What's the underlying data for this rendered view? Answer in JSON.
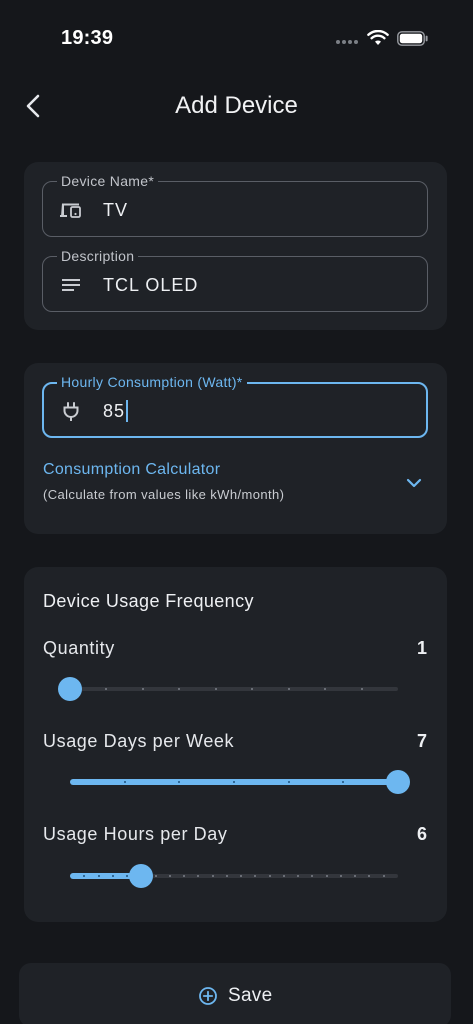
{
  "status_bar": {
    "time": "19:39"
  },
  "app_bar": {
    "title": "Add Device",
    "back_icon": "chevron-left-icon"
  },
  "device_card": {
    "name_field": {
      "label": "Device Name*",
      "value": "TV",
      "icon": "devices-icon"
    },
    "description_field": {
      "label": "Description",
      "value": "TCL OLED",
      "icon": "notes-icon"
    }
  },
  "consumption_card": {
    "hourly_field": {
      "label": "Hourly Consumption (Watt)*",
      "value": "85",
      "icon": "plug-icon"
    },
    "calculator": {
      "title": "Consumption Calculator",
      "subtitle": "(Calculate from values like kWh/month)",
      "icon": "chevron-down-icon"
    }
  },
  "usage_card": {
    "title": "Device Usage Frequency",
    "sliders": [
      {
        "label": "Quantity",
        "value": "1",
        "min": 1,
        "max": 10,
        "current": 1
      },
      {
        "label": "Usage Days per Week",
        "value": "7",
        "min": 1,
        "max": 7,
        "current": 7
      },
      {
        "label": "Usage Hours per Day",
        "value": "6",
        "min": 1,
        "max": 24,
        "current": 6
      }
    ]
  },
  "save_button": {
    "label": "Save",
    "icon": "plus-circle-icon"
  },
  "colors": {
    "accent": "#6db7f0",
    "background": "#15171b",
    "card": "#1f2227"
  }
}
